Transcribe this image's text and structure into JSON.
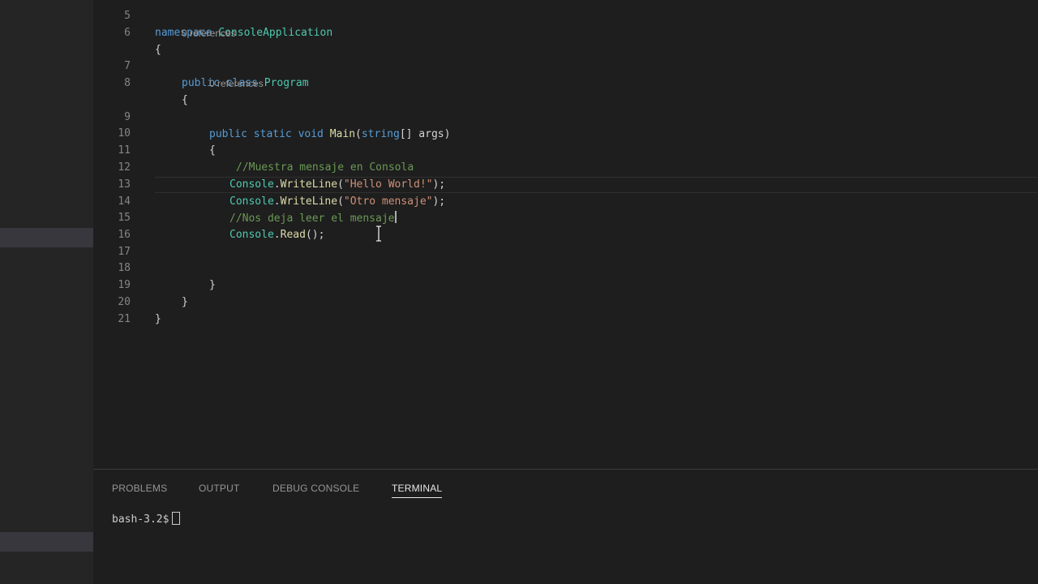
{
  "editor": {
    "codelens": {
      "class_refs": "0 references",
      "method_refs": "0 references"
    },
    "lines": {
      "l5": {
        "num": "5",
        "kw": "namespace",
        "name": "ConsoleApplication"
      },
      "l6": {
        "num": "6",
        "text": "{"
      },
      "l7": {
        "num": "7",
        "kw": "public class",
        "name": "Program"
      },
      "l8": {
        "num": "8",
        "text": "{"
      },
      "l9": {
        "num": "9",
        "kw": "public static void",
        "fn": "Main",
        "open": "(",
        "type": "string",
        "rest": "[] args)"
      },
      "l10": {
        "num": "10",
        "text": "{"
      },
      "l11": {
        "num": "11",
        "comment": "//Muestra mensaje en Consola"
      },
      "l12": {
        "num": "12",
        "cls": "Console",
        "dot": ".",
        "fn": "WriteLine",
        "open": "(",
        "str": "\"Hello World!\"",
        "close": ");"
      },
      "l13": {
        "num": "13",
        "cls": "Console",
        "dot": ".",
        "fn": "WriteLine",
        "open": "(",
        "str": "\"Otro mensaje\"",
        "close": ");"
      },
      "l14": {
        "num": "14",
        "comment": "//Nos deja leer el mensaje"
      },
      "l15": {
        "num": "15",
        "cls": "Console",
        "dot": ".",
        "fn": "Read",
        "close": "();"
      },
      "l16": {
        "num": "16"
      },
      "l17": {
        "num": "17"
      },
      "l18": {
        "num": "18",
        "text": "}"
      },
      "l19": {
        "num": "19",
        "text": "}"
      },
      "l20": {
        "num": "20",
        "text": "}"
      },
      "l21": {
        "num": "21"
      }
    }
  },
  "panel": {
    "tabs": {
      "problems": "PROBLEMS",
      "output": "OUTPUT",
      "debug_console": "DEBUG CONSOLE",
      "terminal": "TERMINAL"
    },
    "active_tab": "TERMINAL",
    "terminal_prompt": "bash-3.2$"
  },
  "colors": {
    "keyword": "#569cd6",
    "type": "#4ec9b0",
    "function": "#dcdcaa",
    "string": "#ce9178",
    "comment": "#6a9955"
  },
  "icons": {
    "mouse_cursor": "text-ibeam-cursor-icon"
  }
}
